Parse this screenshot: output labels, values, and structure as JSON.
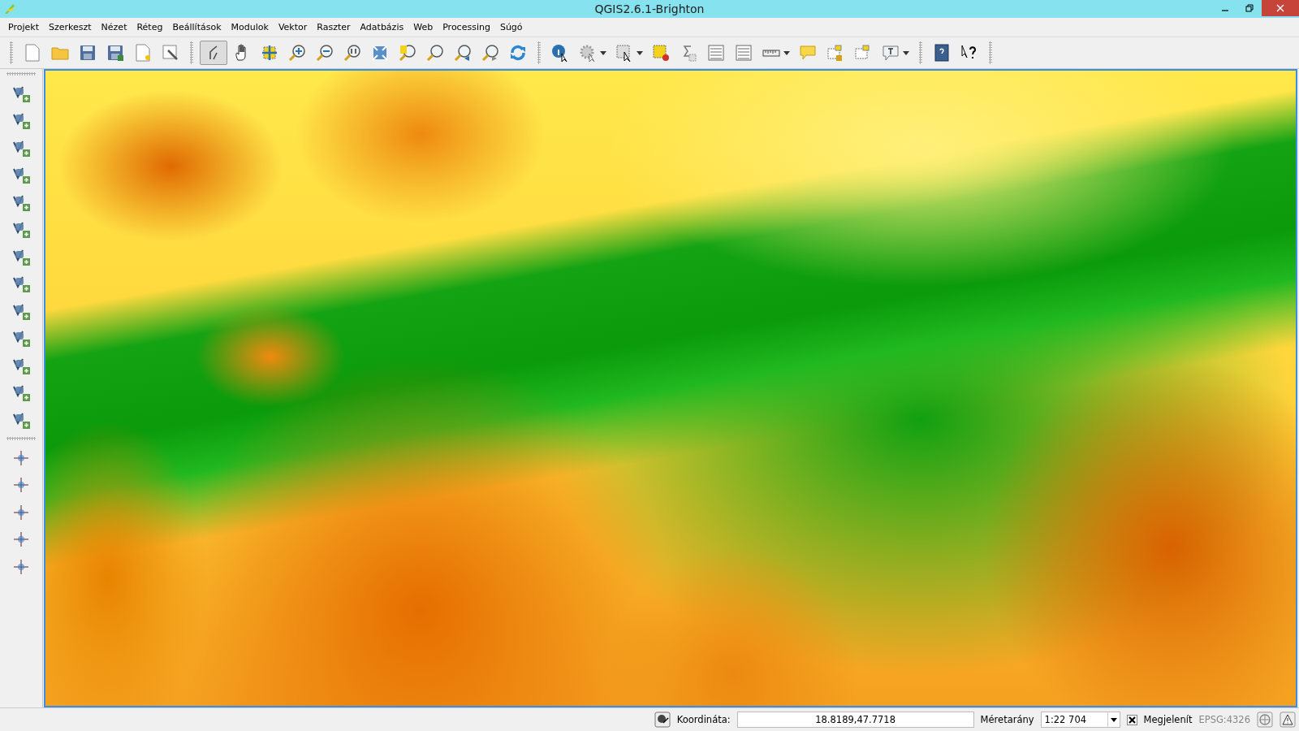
{
  "window": {
    "title": "QGIS2.6.1-Brighton"
  },
  "menu": [
    "Projekt",
    "Szerkeszt",
    "Nézet",
    "Réteg",
    "Beállítások",
    "Modulok",
    "Vektor",
    "Raszter",
    "Adatbázis",
    "Web",
    "Processing",
    "Súgó"
  ],
  "status_bar": {
    "coordinate_label": "Koordináta:",
    "coordinate_value": "18.8189,47.7718",
    "scale_label": "Méretarány",
    "scale_value": "1:22 704",
    "render": {
      "label": "Megjelenít",
      "checked": true
    },
    "crs": "EPSG:4326"
  }
}
